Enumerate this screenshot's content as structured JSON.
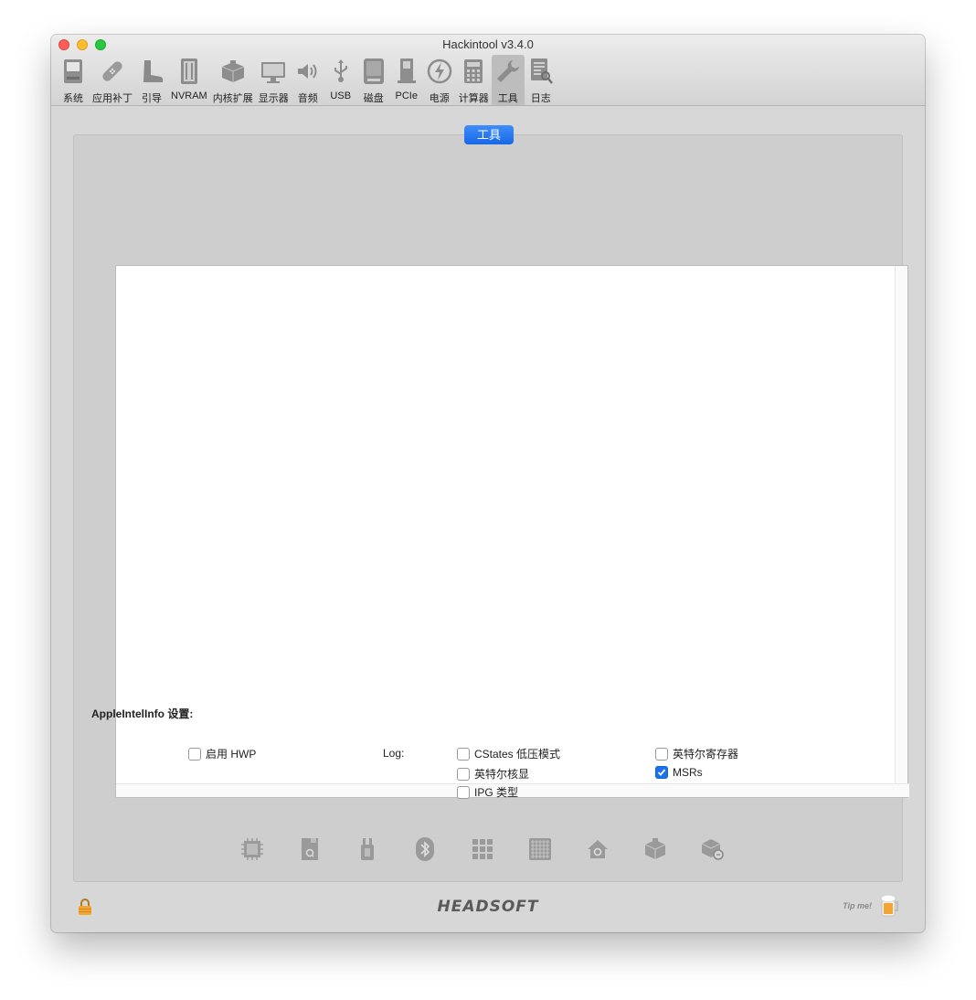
{
  "window": {
    "title": "Hackintool v3.4.0"
  },
  "toolbar": {
    "items": [
      {
        "label": "系统",
        "icon": "system-icon"
      },
      {
        "label": "应用补丁",
        "icon": "patch-icon"
      },
      {
        "label": "引导",
        "icon": "boot-icon"
      },
      {
        "label": "NVRAM",
        "icon": "nvram-icon"
      },
      {
        "label": "内核扩展",
        "icon": "kext-icon"
      },
      {
        "label": "显示器",
        "icon": "display-icon"
      },
      {
        "label": "音频",
        "icon": "audio-icon"
      },
      {
        "label": "USB",
        "icon": "usb-icon"
      },
      {
        "label": "磁盘",
        "icon": "disk-icon"
      },
      {
        "label": "PCIe",
        "icon": "pcie-icon"
      },
      {
        "label": "电源",
        "icon": "power-icon"
      },
      {
        "label": "计算器",
        "icon": "calculator-icon"
      },
      {
        "label": "工具",
        "icon": "tools-icon"
      },
      {
        "label": "日志",
        "icon": "log-icon"
      }
    ],
    "active": "工具"
  },
  "panel": {
    "tab_label": "工具",
    "section_label": "AppleIntelInfo 设置:",
    "options": {
      "enable_hwp": {
        "label": "启用 HWP",
        "checked": false
      },
      "log_label": "Log:",
      "cstates": {
        "label": "CStates 低压模式",
        "checked": false
      },
      "intel_igpu": {
        "label": "英特尔核显",
        "checked": false
      },
      "ipg_type": {
        "label": "IPG 类型",
        "checked": false
      },
      "intel_registers": {
        "label": "英特尔寄存器",
        "checked": false
      },
      "msrs": {
        "label": "MSRs",
        "checked": true
      }
    },
    "bottom_icons": [
      "cpu-icon",
      "sd-card-icon",
      "usb-connector-icon",
      "bluetooth-icon",
      "grid-icon",
      "memory-grid-icon",
      "home-icon",
      "kext-box-icon",
      "kext-box-search-icon"
    ]
  },
  "footer": {
    "brand": "HEADSOFT",
    "tip": "Tip me!"
  },
  "colors": {
    "accent": "#1a72ee",
    "window_bg": "#d7d7d7",
    "panel_bg": "#cecece"
  }
}
